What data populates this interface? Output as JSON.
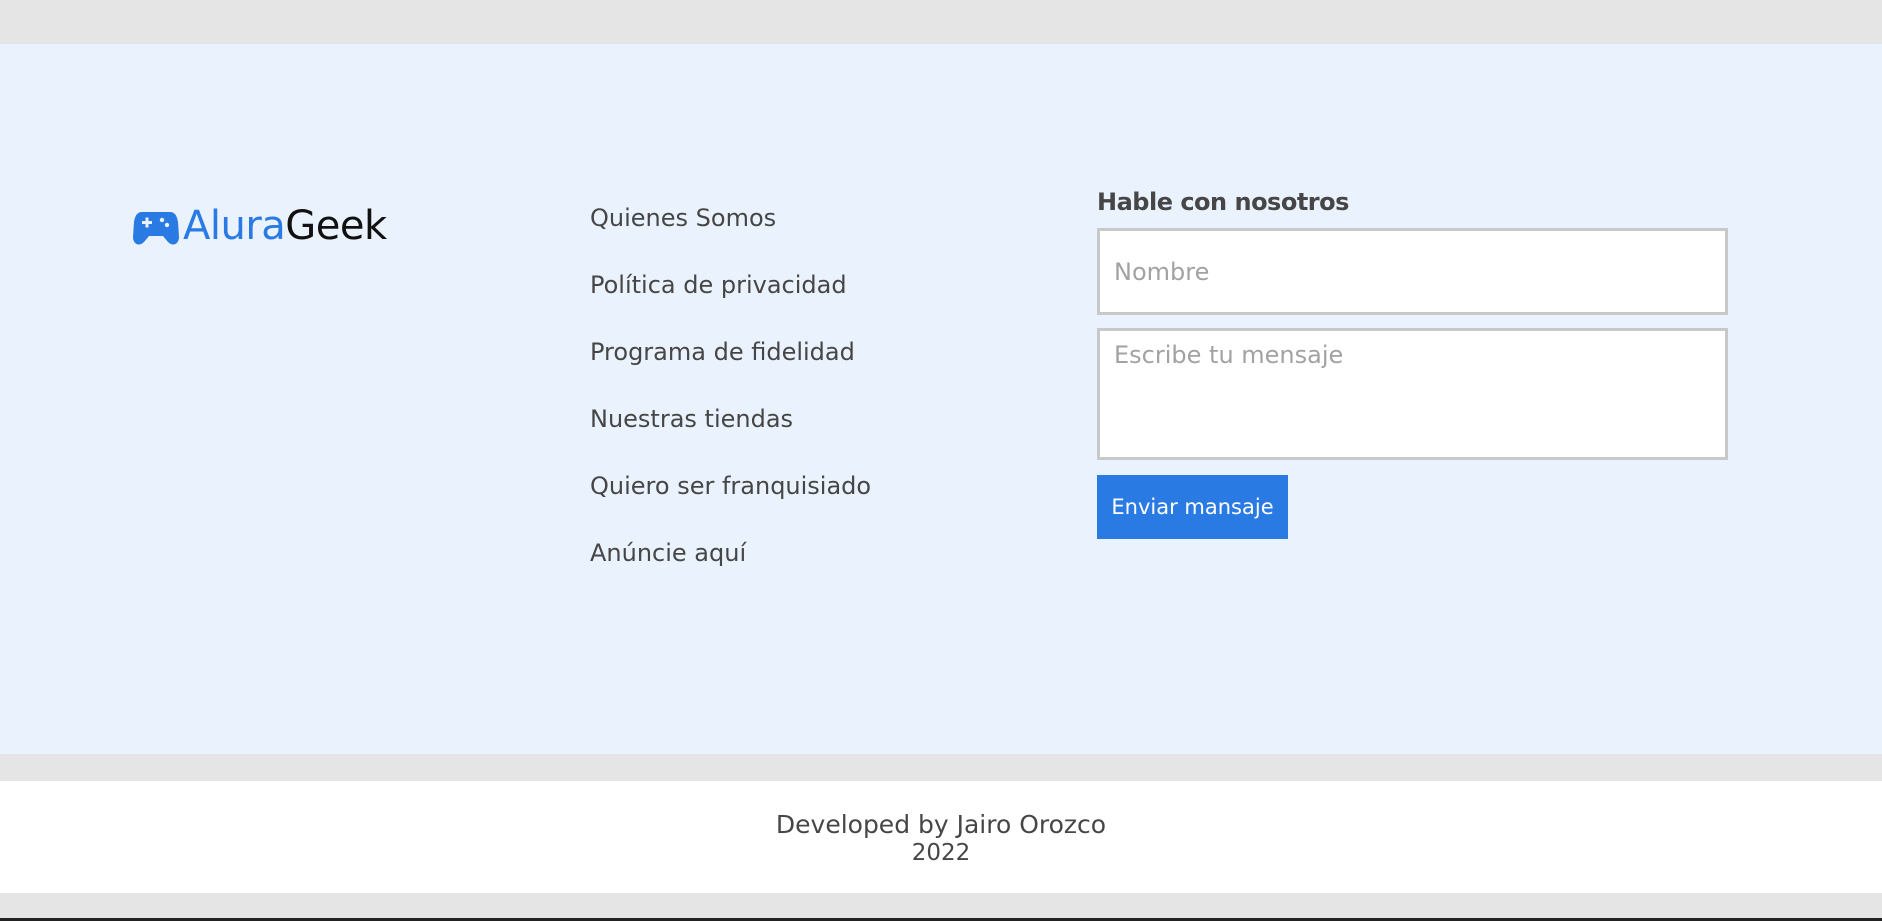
{
  "brand": {
    "name_part1": "Alura",
    "name_part2": "Geek",
    "icon": "gamepad-icon",
    "accent_color": "#2a7ae4"
  },
  "footer_links": [
    {
      "label": "Quienes Somos"
    },
    {
      "label": "Política de privacidad"
    },
    {
      "label": "Programa de fidelidad"
    },
    {
      "label": "Nuestras tiendas"
    },
    {
      "label": "Quiero ser franquisiado"
    },
    {
      "label": "Anúncie aquí"
    }
  ],
  "contact_form": {
    "title": "Hable con nosotros",
    "name_field": {
      "value": "",
      "placeholder": "Nombre"
    },
    "message_field": {
      "value": "",
      "placeholder": "Escribe tu mensaje"
    },
    "submit_label": "Enviar mansaje"
  },
  "credits": {
    "line1": "Developed by Jairo Orozco",
    "line2": "2022"
  },
  "colors": {
    "footer_background": "#eaf2fd",
    "page_background": "#e5e5e5",
    "text": "#464646",
    "button": "#2a7ae4"
  }
}
